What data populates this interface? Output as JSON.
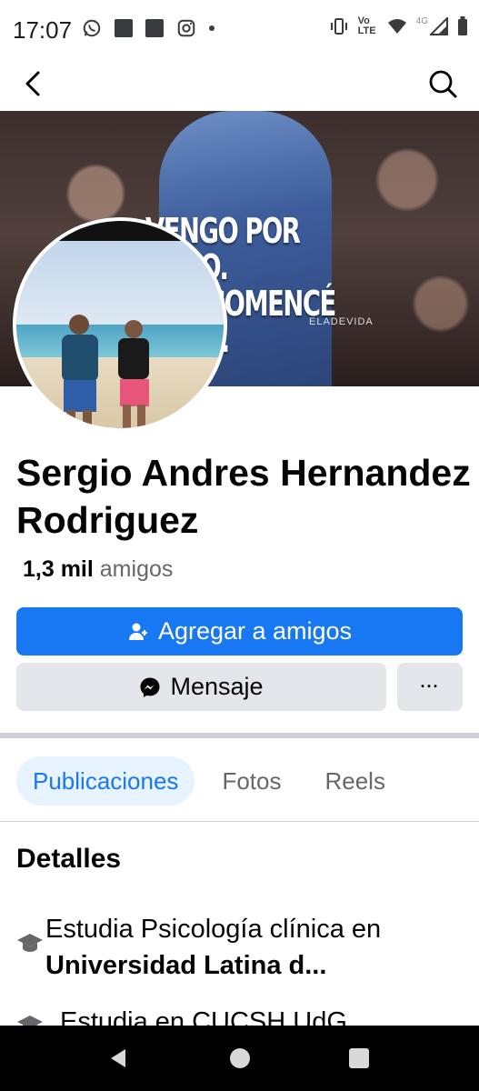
{
  "status_bar": {
    "time": "17:07",
    "lte_label": "Vo LTE",
    "network_label": "4G"
  },
  "cover": {
    "line1": "VENGO POR TODO.",
    "line2": "QUE COMENCÉ",
    "line3": "NADA.",
    "tag": "ELADEVIDA"
  },
  "profile": {
    "name": "Sergio Andres Hernandez Rodriguez",
    "friends_count": "1,3 mil",
    "friends_label": "amigos"
  },
  "actions": {
    "add_friend_label": "Agregar a amigos",
    "message_label": "Mensaje",
    "more_label": "···"
  },
  "tabs": [
    {
      "label": "Publicaciones",
      "active": true
    },
    {
      "label": "Fotos",
      "active": false
    },
    {
      "label": "Reels",
      "active": false
    }
  ],
  "details": {
    "title": "Detalles",
    "items": [
      {
        "icon": "graduation-cap-icon",
        "prefix": "Estudia Psicología clínica en",
        "bold": "Universidad Latina d..."
      },
      {
        "icon": "graduation-cap-icon",
        "prefix": "Estudia en CUCSH UdG",
        "bold": ""
      }
    ]
  },
  "colors": {
    "primary": "#1877f2",
    "secondary_button": "#e4e6eb",
    "active_tab_bg": "#e7f3ff",
    "text_muted": "#65676b"
  }
}
